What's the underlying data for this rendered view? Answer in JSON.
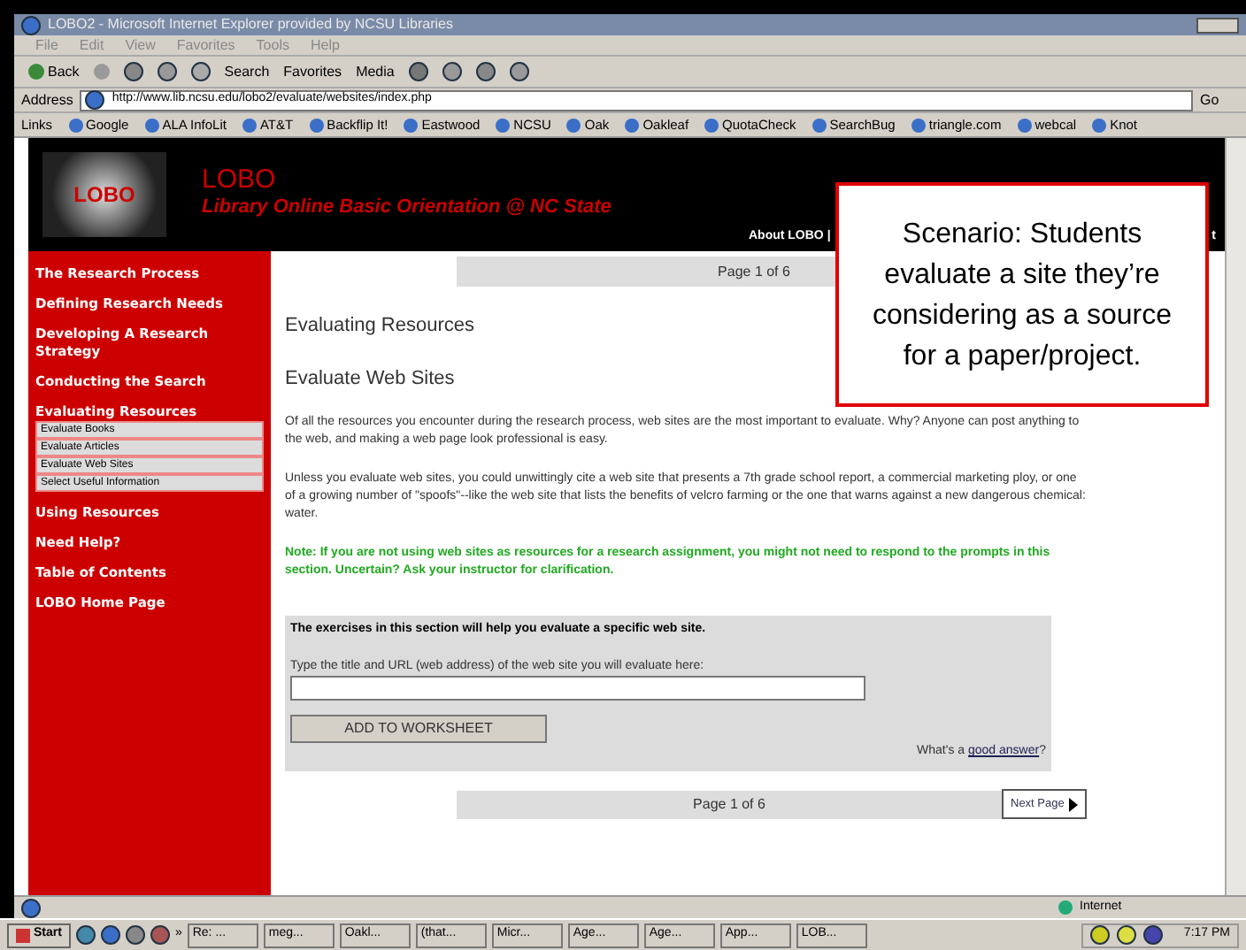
{
  "window": {
    "title": "LOBO2 - Microsoft Internet Explorer provided by NCSU Libraries"
  },
  "menu": [
    "File",
    "Edit",
    "View",
    "Favorites",
    "Tools",
    "Help"
  ],
  "toolbar": {
    "back": "Back",
    "search": "Search",
    "favorites": "Favorites",
    "media": "Media"
  },
  "address": {
    "label": "Address",
    "value": "http://www.lib.ncsu.edu/lobo2/evaluate/websites/index.php",
    "go": "Go"
  },
  "links": {
    "label": "Links",
    "items": [
      "Google",
      "ALA InfoLit",
      "AT&T",
      "Backflip It!",
      "Eastwood",
      "NCSU",
      "Oak",
      "Oakleaf",
      "QuotaCheck",
      "SearchBug",
      "triangle.com",
      "webcal",
      "Knot"
    ]
  },
  "header": {
    "logo": "LOBO",
    "title": "LOBO",
    "subtitle": "Library Online Basic Orientation @ NC State",
    "link": "About LOBO |",
    "link_tail": "t"
  },
  "sidebar": [
    {
      "label": "The Research Process"
    },
    {
      "label": "Defining Research Needs"
    },
    {
      "label": "Developing A Research Strategy"
    },
    {
      "label": "Conducting the Search"
    },
    {
      "label": "Evaluating Resources",
      "children": [
        {
          "label": "Evaluate Books"
        },
        {
          "label": "Evaluate Articles"
        },
        {
          "label": "Evaluate Web Sites"
        },
        {
          "label": "Select Useful Information"
        }
      ]
    },
    {
      "label": "Using Resources"
    },
    {
      "label": "Need Help?"
    },
    {
      "label": "Table of Contents"
    },
    {
      "label": "LOBO Home Page"
    }
  ],
  "content": {
    "pager_top": "Page 1 of 6",
    "heading": "Evaluating Resources",
    "subheading": "Evaluate Web Sites",
    "paragraphs": [
      "Of all the resources you encounter during the research process, web sites are the most important to evaluate. Why? Anyone can post anything to the web, and making a web page look professional is easy.",
      "Unless you evaluate web sites, you could unwittingly cite a web site that presents a 7th grade school report, a commercial marketing ploy, or one of a growing number of \"spoofs\"--like the web site that lists the benefits of velcro farming or the one that warns against a new dangerous chemical: water."
    ],
    "note": "Note: If you are not using web sites as resources for a research assignment, you might not need to respond to the prompts in this section. Uncertain? Ask your instructor for clarification.",
    "exercise": {
      "intro": "The exercises in this section will help you evaluate a specific web site.",
      "prompt": "Type the title and URL (web address) of the web site you will evaluate here:",
      "button": "ADD TO WORKSHEET",
      "help_prefix": "What's a",
      "help_link": "good answer",
      "help_suffix": "?"
    },
    "pager_bottom": "Page 1 of 6",
    "next": "Next Page"
  },
  "callout": "Scenario: Students evaluate a site they’re considering as a source for a paper/project.",
  "status_bar": {
    "zone": "Internet"
  },
  "taskbar": {
    "start": "Start",
    "more": "»",
    "tasks": [
      "Re: ...",
      "meg...",
      "Oakl...",
      "(that...",
      "Micr...",
      "Age...",
      "Age...",
      "App...",
      "LOB..."
    ],
    "clock": "7:17 PM"
  }
}
